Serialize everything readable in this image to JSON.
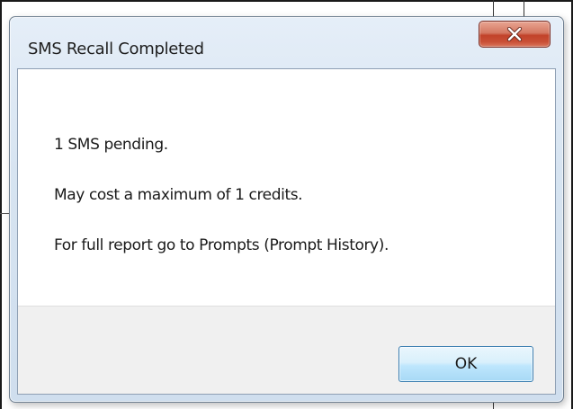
{
  "dialog": {
    "title": "SMS Recall Completed",
    "close_icon": "close-icon",
    "messages": [
      "1 SMS pending.",
      "May cost a maximum of 1 credits.",
      "For full report go to Prompts (Prompt History)."
    ],
    "ok_label": "OK"
  },
  "colors": {
    "close_button": "#c94f36",
    "ok_border": "#3c7fb1",
    "button_area": "#f0f0f0"
  }
}
